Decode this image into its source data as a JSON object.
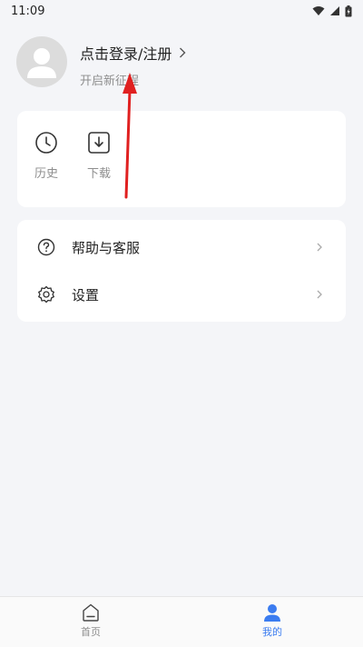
{
  "status_bar": {
    "time": "11:09"
  },
  "profile": {
    "login_label": "点击登录/注册",
    "subtitle": "开启新征程"
  },
  "quick_actions": [
    {
      "label": "历史",
      "icon": "clock-icon"
    },
    {
      "label": "下载",
      "icon": "download-icon"
    }
  ],
  "menu": [
    {
      "label": "帮助与客服",
      "icon": "help-circle-icon"
    },
    {
      "label": "设置",
      "icon": "gear-icon"
    }
  ],
  "bottom_nav": [
    {
      "label": "首页",
      "icon": "home-icon",
      "active": false
    },
    {
      "label": "我的",
      "icon": "person-icon",
      "active": true
    }
  ],
  "colors": {
    "accent": "#3b7cf0",
    "background": "#f4f5f8",
    "annotation_arrow": "#e02020"
  }
}
